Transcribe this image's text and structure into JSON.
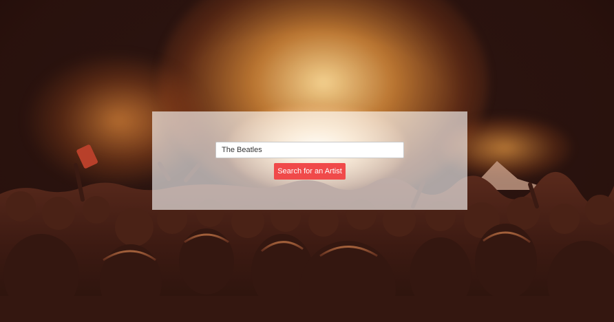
{
  "search": {
    "value": "The Beatles",
    "button_label": "Search for an Artist"
  },
  "colors": {
    "button_background": "#f04a4a",
    "button_text": "#ffffff",
    "panel_overlay": "rgba(255,255,255,0.62)"
  },
  "background": {
    "description_icon": "concert-crowd-photo"
  }
}
